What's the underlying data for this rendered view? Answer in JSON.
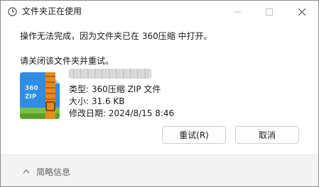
{
  "window": {
    "title": "文件夹正在使用"
  },
  "message": {
    "line1": "操作无法完成，因为文件夹已在 360压缩 中打开。",
    "line2": "请关闭该文件夹并重试。"
  },
  "file": {
    "icon": "360-zip-archive-icon",
    "type_line": "类型: 360压缩 ZIP 文件",
    "size_line": "大小: 31.6 KB",
    "modified_line": "修改日期: 2024/8/15 8:46"
  },
  "buttons": {
    "retry": "重试(R)",
    "cancel": "取消"
  },
  "footer": {
    "details_label": "简略信息"
  },
  "colors": {
    "icon_blue": "#2f8de4",
    "icon_orange": "#e58a1f",
    "icon_green": "#7bc043"
  }
}
